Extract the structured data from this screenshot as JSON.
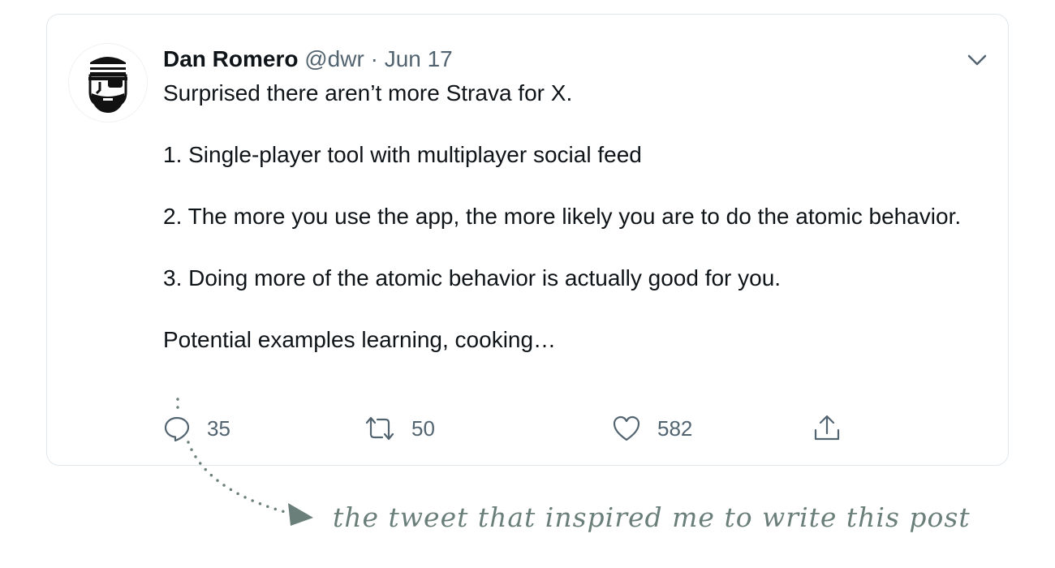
{
  "tweet": {
    "author_name": "Dan Romero",
    "handle": "@dwr",
    "separator": "·",
    "date": "Jun 17",
    "paragraphs": [
      "Surprised there aren’t more Strava for X.",
      "1. Single-player tool with multiplayer social feed",
      "2. The more you use the app, the more likely you are to do the atomic behavior.",
      "3. Doing more of the atomic behavior is actually good for you.",
      "Potential examples learning, cooking…"
    ],
    "actions": {
      "replies": "35",
      "retweets": "50",
      "likes": "582"
    }
  },
  "annotation": {
    "text": "the tweet that inspired me to write this post"
  },
  "icons": [
    "pirate-avatar",
    "chevron-down-icon",
    "reply-icon",
    "retweet-icon",
    "heart-icon",
    "share-icon"
  ],
  "colors": {
    "text": "#0f1419",
    "muted": "#536471",
    "border": "#e1e8ed",
    "annotation": "#6b7f7a"
  }
}
